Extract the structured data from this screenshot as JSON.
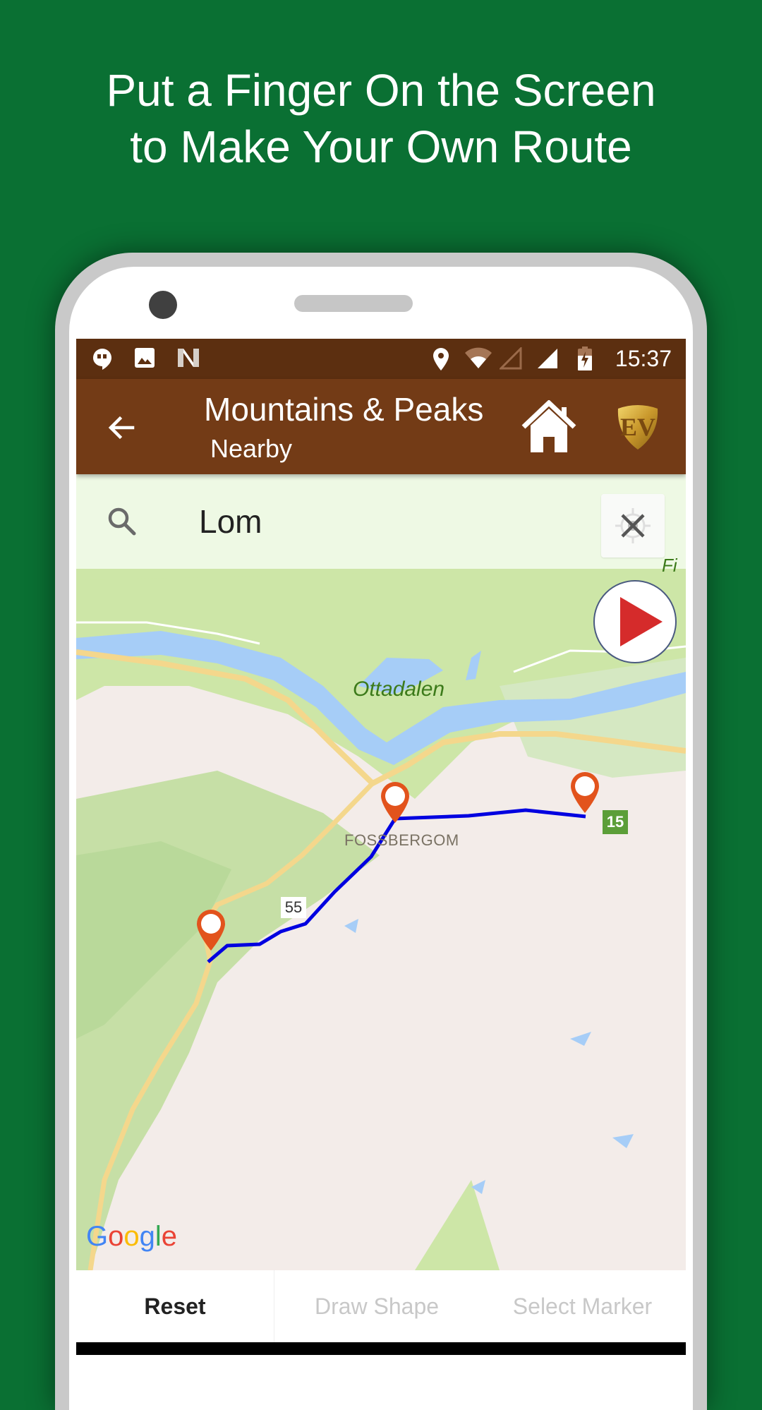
{
  "promo": {
    "headline_line1": "Put a Finger On the Screen",
    "headline_line2": "to Make Your Own Route",
    "background_color": "#0a7033"
  },
  "status_bar": {
    "left_icons": [
      "hangouts-icon",
      "image-icon",
      "n-icon"
    ],
    "right_icons": [
      "location-icon",
      "wifi-icon",
      "signal-empty-icon",
      "signal-icon",
      "battery-charging-icon"
    ],
    "time": "15:37"
  },
  "toolbar": {
    "title": "Mountains & Peaks",
    "subtitle": "Nearby",
    "back_icon": "arrow-back-icon",
    "home_icon": "home-icon",
    "logo": "EV",
    "color": "#733b16"
  },
  "search": {
    "value": "Lom",
    "search_icon": "search-icon",
    "clear_icon": "close-icon"
  },
  "map": {
    "labels": {
      "region": "Ottadalen",
      "town": "FOSSBERGOM",
      "road_55": "55",
      "road_15": "15",
      "partial_label": "Fi"
    },
    "attribution": "Google",
    "route_color": "#0000e0",
    "marker_color": "#e2531c",
    "markers": 3
  },
  "bottom_bar": {
    "buttons": [
      {
        "label": "Reset",
        "enabled": true
      },
      {
        "label": "Draw Shape",
        "enabled": false
      },
      {
        "label": "Select Marker",
        "enabled": false
      }
    ]
  }
}
